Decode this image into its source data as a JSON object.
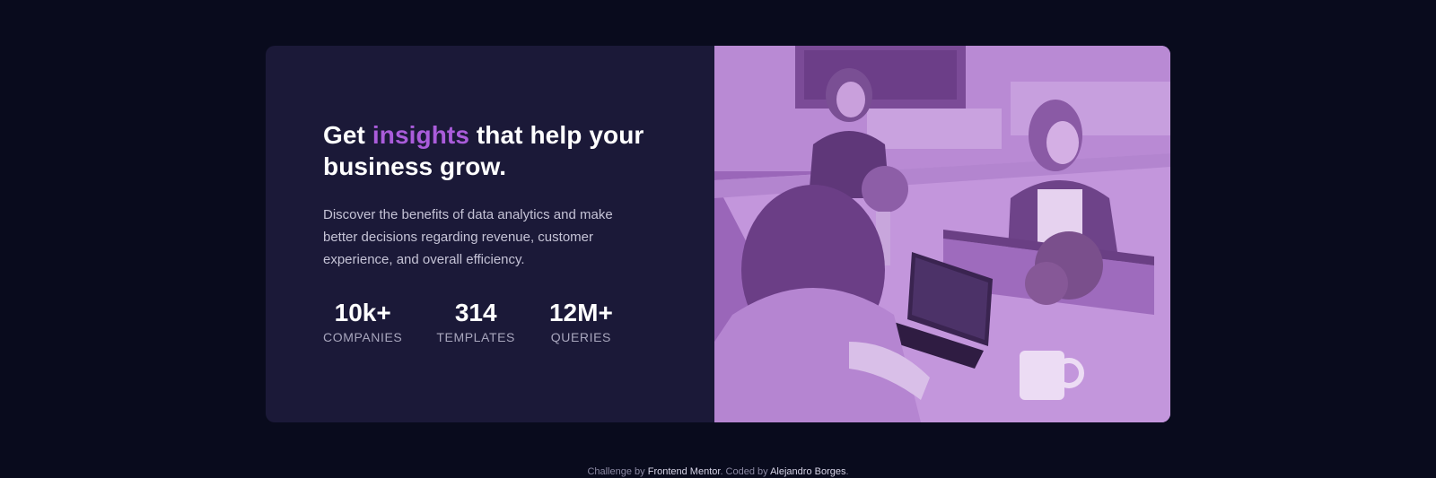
{
  "card": {
    "headline_prefix": "Get ",
    "headline_accent": "insights",
    "headline_suffix": " that help your business grow.",
    "description": "Discover the benefits of data analytics and make better decisions regarding revenue, customer experience, and overall efficiency.",
    "stats": [
      {
        "value": "10k+",
        "label": "COMPANIES"
      },
      {
        "value": "314",
        "label": "TEMPLATES"
      },
      {
        "value": "12M+",
        "label": "QUERIES"
      }
    ],
    "image_icon": "office-meeting-photo"
  },
  "footer": {
    "prefix": "Challenge by ",
    "challenge_link": "Frontend Mentor",
    "middle": ". Coded by ",
    "author_link": "Alejandro Borges",
    "suffix": "."
  },
  "colors": {
    "background": "#090b1d",
    "card": "#1b1938",
    "accent": "#aa5cdb",
    "photo_tint": "#a672c4"
  }
}
